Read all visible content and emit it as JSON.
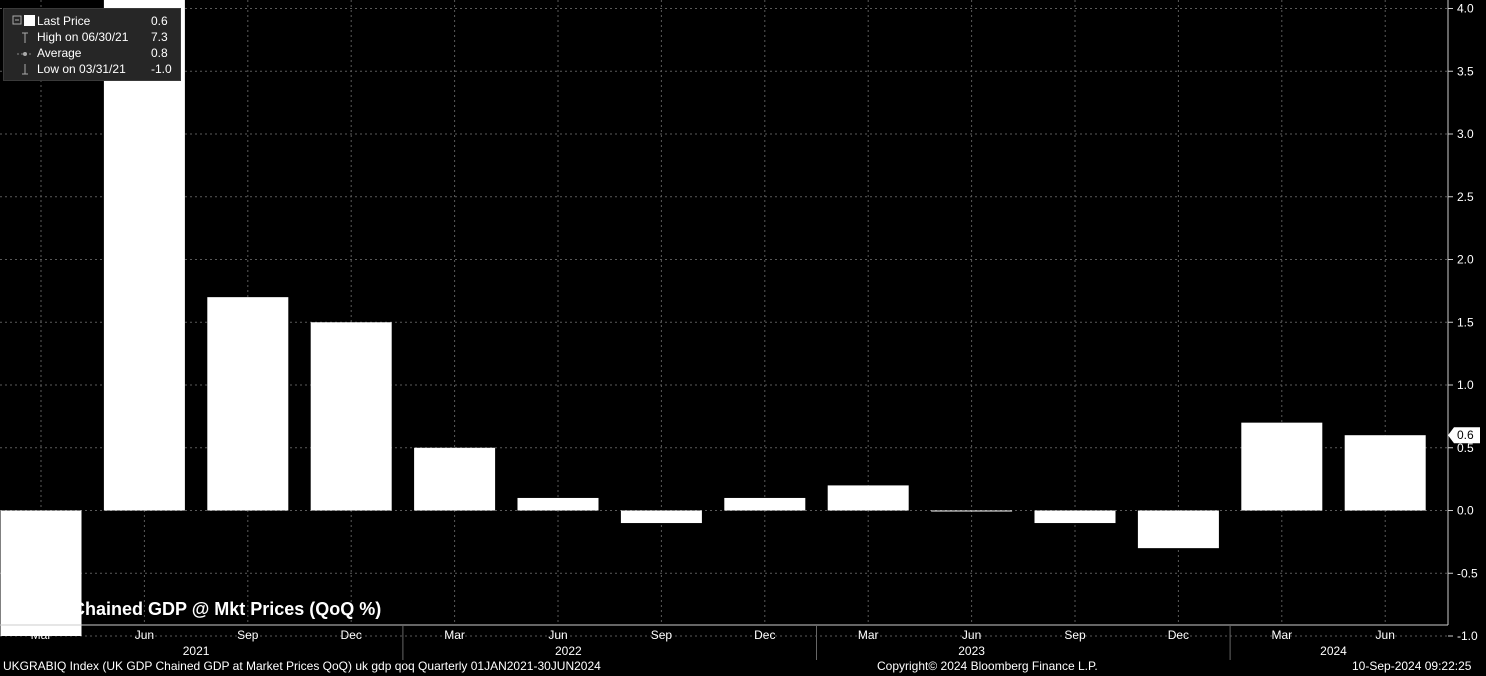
{
  "chart_data": {
    "type": "bar",
    "title": "UK Chained GDP @ Mkt Prices (QoQ %)",
    "categories": [
      "Mar",
      "Jun",
      "Sep",
      "Dec",
      "Mar",
      "Jun",
      "Sep",
      "Dec",
      "Mar",
      "Jun",
      "Sep",
      "Dec",
      "Mar",
      "Jun"
    ],
    "years": [
      {
        "label": "2021"
      },
      {
        "label": "2022"
      },
      {
        "label": "2023"
      },
      {
        "label": "2024"
      }
    ],
    "values": [
      -1.0,
      7.3,
      1.7,
      1.5,
      0.5,
      0.1,
      -0.1,
      0.1,
      0.2,
      0.0,
      -0.1,
      -0.3,
      0.7,
      0.6
    ],
    "ylim": [
      -1.75,
      8.0
    ],
    "yticks": [
      "8.0",
      "7.5",
      "7.0",
      "6.5",
      "6.0",
      "5.5",
      "5.0",
      "4.5",
      "4.0",
      "3.5",
      "3.0",
      "2.5",
      "2.0",
      "1.5",
      "1.0",
      "0.5",
      "0.0",
      "-0.5",
      "-1.0",
      "-1.5"
    ],
    "last_value_label": "0.6",
    "grid": true,
    "bar_color": "#ffffff",
    "background": "#000000"
  },
  "legend": {
    "rows": [
      {
        "label": "Last Price",
        "value": "0.6"
      },
      {
        "label": "High on 06/30/21",
        "value": "7.3"
      },
      {
        "label": "Average",
        "value": "0.8"
      },
      {
        "label": "Low on 03/31/21",
        "value": "-1.0"
      }
    ]
  },
  "footer": {
    "left": "UKGRABIQ Index (UK GDP Chained GDP at Market Prices QoQ) uk gdp qoq  Quarterly 01JAN2021-30JUN2024",
    "center": "Copyright© 2024 Bloomberg Finance L.P.",
    "right": "10-Sep-2024 09:22:25"
  }
}
